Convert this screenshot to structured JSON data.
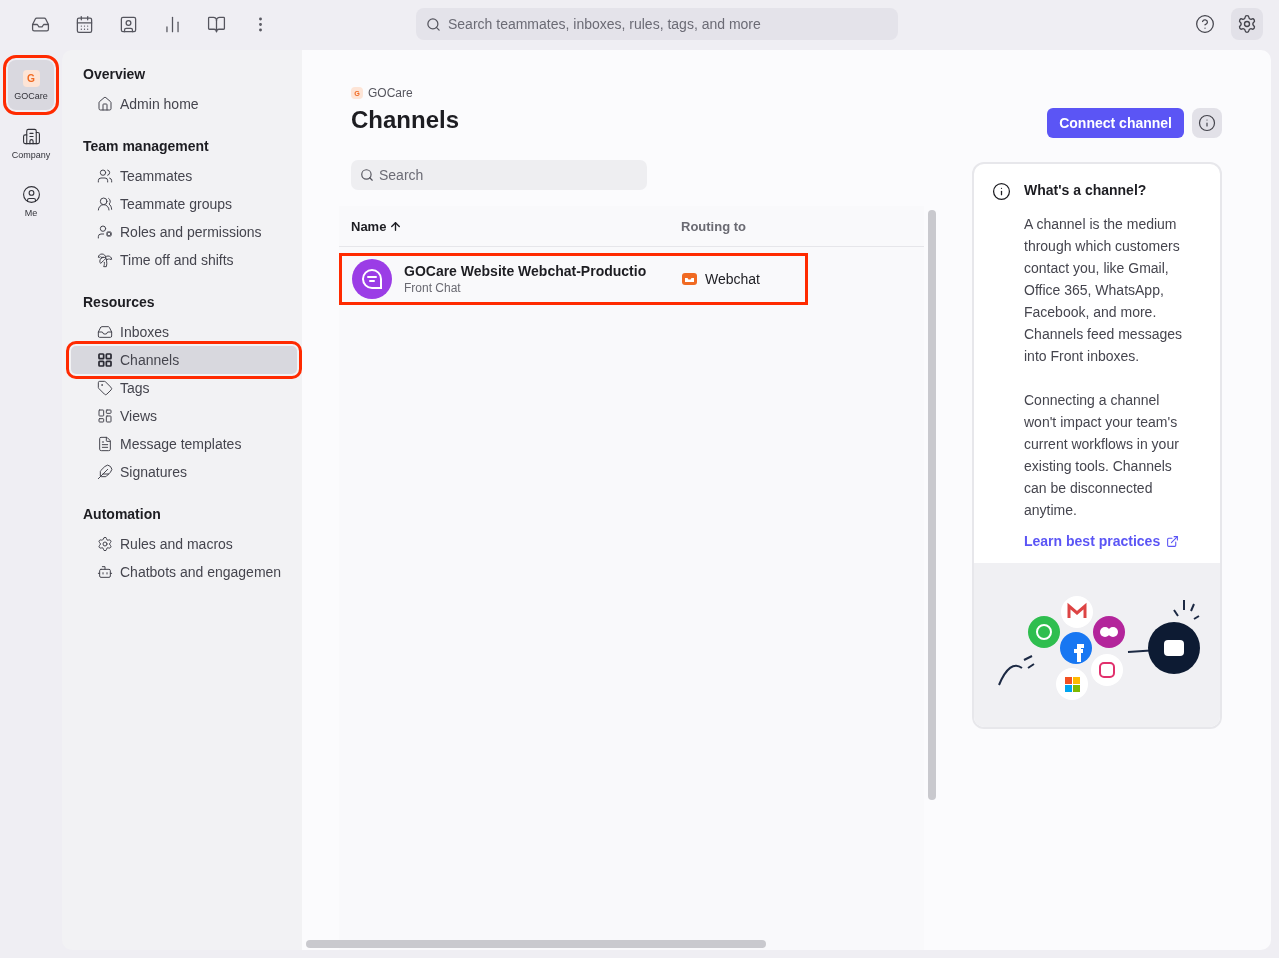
{
  "global_search": {
    "placeholder": "Search teammates, inboxes, rules, tags, and more"
  },
  "rail": [
    {
      "label": "GOCare",
      "initial": "G",
      "selected": true,
      "highlighted": true
    },
    {
      "label": "Company",
      "selected": false,
      "highlighted": false
    },
    {
      "label": "Me",
      "selected": false,
      "highlighted": false
    }
  ],
  "sidebar": {
    "sections": [
      {
        "heading": "Overview",
        "items": [
          {
            "label": "Admin home",
            "selected": false,
            "highlighted": false
          }
        ]
      },
      {
        "heading": "Team management",
        "items": [
          {
            "label": "Teammates",
            "selected": false,
            "highlighted": false
          },
          {
            "label": "Teammate groups",
            "selected": false,
            "highlighted": false
          },
          {
            "label": "Roles and permissions",
            "selected": false,
            "highlighted": false
          },
          {
            "label": "Time off and shifts",
            "selected": false,
            "highlighted": false
          }
        ]
      },
      {
        "heading": "Resources",
        "items": [
          {
            "label": "Inboxes",
            "selected": false,
            "highlighted": false
          },
          {
            "label": "Channels",
            "selected": true,
            "highlighted": true
          },
          {
            "label": "Tags",
            "selected": false,
            "highlighted": false
          },
          {
            "label": "Views",
            "selected": false,
            "highlighted": false
          },
          {
            "label": "Message templates",
            "selected": false,
            "highlighted": false
          },
          {
            "label": "Signatures",
            "selected": false,
            "highlighted": false
          }
        ]
      },
      {
        "heading": "Automation",
        "items": [
          {
            "label": "Rules and macros",
            "selected": false,
            "highlighted": false
          },
          {
            "label": "Chatbots and engagemen",
            "selected": false,
            "highlighted": false
          }
        ]
      }
    ]
  },
  "workspace": {
    "initial": "G",
    "name": "GOCare"
  },
  "title": "Channels",
  "connect_button": "Connect channel",
  "search": {
    "placeholder": "Search"
  },
  "table": {
    "columns": [
      {
        "label": "Name",
        "sorted": true
      },
      {
        "label": "Routing to",
        "sorted": false
      }
    ],
    "rows": [
      {
        "name": "GOCare Website Webchat-Productio",
        "subtitle": "Front Chat",
        "routing": "Webchat",
        "highlighted": true
      }
    ]
  },
  "info_card": {
    "title": "What's a channel?",
    "paragraphs": [
      "A channel is the medium through which customers contact you, like Gmail, Office 365, WhatsApp, Facebook, and more. Channels feed messages into Front inboxes.",
      "Connecting a channel won't impact your team's current workflows in your existing tools. Channels can be disconnected anytime."
    ],
    "link": "Learn best practices"
  }
}
